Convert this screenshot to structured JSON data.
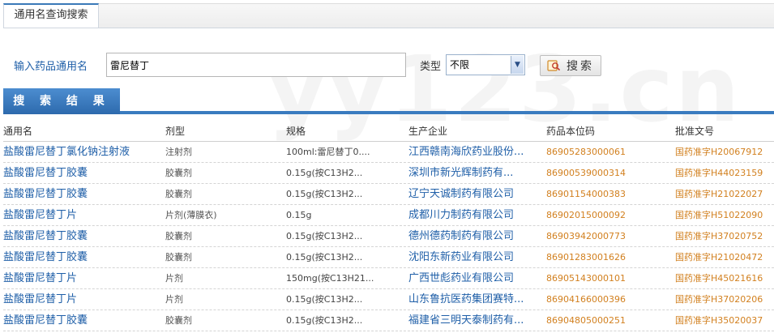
{
  "tab": {
    "title": "通用名查询搜索"
  },
  "search": {
    "label": "输入药品通用名",
    "value": "雷尼替丁",
    "type_label": "类型",
    "type_selected": "不限",
    "button_label": "搜索"
  },
  "results": {
    "header_label": "搜 索 结 果",
    "columns": [
      "通用名",
      "剂型",
      "规格",
      "生产企业",
      "药品本位码",
      "批准文号"
    ],
    "rows": [
      [
        "盐酸雷尼替丁氯化钠注射液",
        "注射剂",
        "100ml:雷尼替丁0....",
        "江西赣南海欣药业股份...",
        "86905283000061",
        "国药准字H20067912"
      ],
      [
        "盐酸雷尼替丁胶囊",
        "胶囊剂",
        "0.15g(按C13H2...",
        "深圳市新光辉制药有...",
        "86900539000314",
        "国药准字H44023159"
      ],
      [
        "盐酸雷尼替丁胶囊",
        "胶囊剂",
        "0.15g(按C13H2...",
        "辽宁天诚制药有限公司",
        "86901154000383",
        "国药准字H21022027"
      ],
      [
        "盐酸雷尼替丁片",
        "片剂(薄膜衣)",
        "0.15g",
        "成都川力制药有限公司",
        "86902015000092",
        "国药准字H51022090"
      ],
      [
        "盐酸雷尼替丁胶囊",
        "胶囊剂",
        "0.15g(按C13H2...",
        "德州德药制药有限公司",
        "86903942000773",
        "国药准字H37020752"
      ],
      [
        "盐酸雷尼替丁胶囊",
        "胶囊剂",
        "0.15g(按C13H2...",
        "沈阳东新药业有限公司",
        "86901283001626",
        "国药准字H21020472"
      ],
      [
        "盐酸雷尼替丁片",
        "片剂",
        "150mg(按C13H21...",
        "广西世彪药业有限公司",
        "86905143000101",
        "国药准字H45021616"
      ],
      [
        "盐酸雷尼替丁片",
        "片剂",
        "0.15g(按C13H2...",
        "山东鲁抗医药集团赛特...",
        "86904166000396",
        "国药准字H37020206"
      ],
      [
        "盐酸雷尼替丁胶囊",
        "胶囊剂",
        "0.15g(按C13H2...",
        "福建省三明天泰制药有...",
        "86904805000251",
        "国药准字H35020037"
      ]
    ]
  },
  "watermark": "yy123.cn",
  "colors": {
    "accent": "#3a7bbf",
    "link": "#1f5fa8",
    "code": "#d2801f"
  }
}
